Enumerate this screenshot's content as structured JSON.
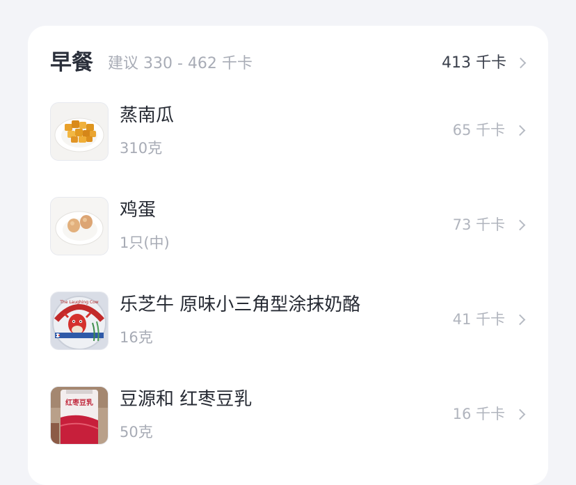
{
  "meal": {
    "title": "早餐",
    "suggestion": "建议 330 - 462 千卡",
    "total": "413 千卡"
  },
  "foods": [
    {
      "name": "蒸南瓜",
      "amount": "310克",
      "kcal": "65 千卡",
      "thumb": "steamed-pumpkin"
    },
    {
      "name": "鸡蛋",
      "amount": "1只(中)",
      "kcal": "73 千卡",
      "thumb": "eggs"
    },
    {
      "name": "乐芝牛 原味小三角型涂抹奶酪",
      "amount": "16克",
      "kcal": "41 千卡",
      "thumb": "laughing-cow-cheese",
      "thumb_text": "The Laughing Cow"
    },
    {
      "name": "豆源和 红枣豆乳",
      "amount": "50克",
      "kcal": "16 千卡",
      "thumb": "red-date-soy-milk",
      "thumb_text": "红枣豆乳"
    }
  ],
  "colors": {
    "background": "#f3f4f8",
    "card": "#ffffff",
    "primary_text": "#262a33",
    "secondary_text": "#a7abb5",
    "chevron": "#b6bac3"
  }
}
